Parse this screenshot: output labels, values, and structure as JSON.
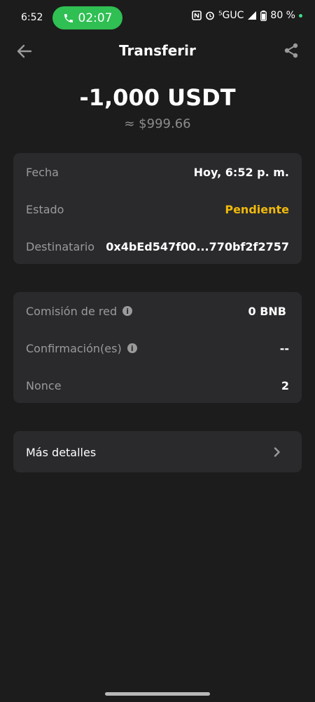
{
  "status_bar": {
    "time": "6:52",
    "call_timer": "02:07",
    "network": "⁵GUC",
    "battery": "80 %",
    "icons": [
      "nfc-icon",
      "alarm-icon",
      "signal-icon",
      "battery-icon"
    ]
  },
  "header": {
    "title": "Transferir",
    "back_icon": "arrow-left-icon",
    "share_icon": "share-icon"
  },
  "amount": {
    "value": "-1,000 USDT",
    "fiat": "≈ $999.66"
  },
  "details": [
    {
      "label": "Fecha",
      "value": "Hoy, 6:52 p. m."
    },
    {
      "label": "Estado",
      "value": "Pendiente"
    },
    {
      "label": "Destinatario",
      "value": "0x4bEd547f00...770bf2f2757"
    }
  ],
  "fees": [
    {
      "label": "Comisión de red",
      "value": "0 BNB",
      "info": true
    },
    {
      "label": "Confirmación(es)",
      "value": "--",
      "info": true
    },
    {
      "label": "Nonce",
      "value": "2",
      "info": false
    }
  ],
  "more": {
    "label": "Más detalles"
  },
  "colors": {
    "background": "#1c1c1c",
    "card": "#2a2a2d",
    "pending": "#f0b90b",
    "call_pill": "#2fbf53"
  }
}
